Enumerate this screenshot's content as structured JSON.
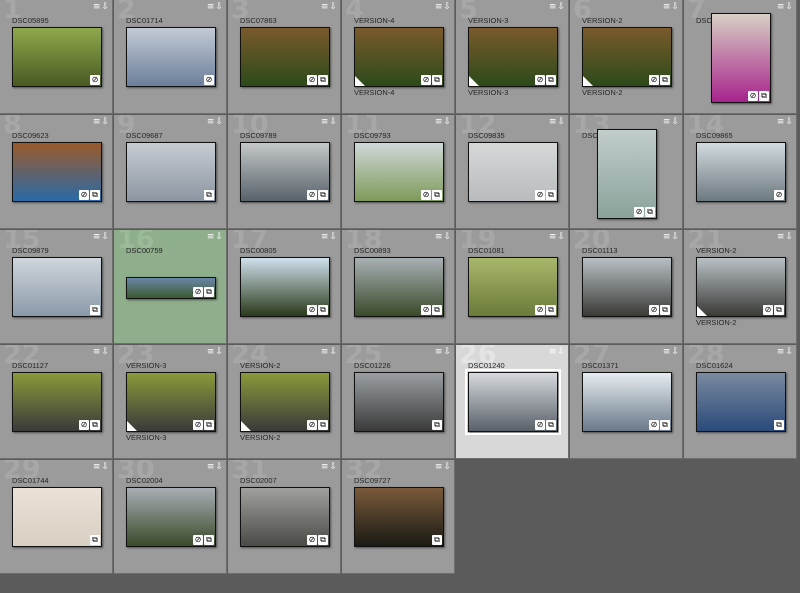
{
  "cells": [
    {
      "num": "1",
      "name": "DSC05895",
      "colors": [
        "#4a5a24",
        "#8fa84a"
      ],
      "orient": "land",
      "icons": [
        "tag"
      ]
    },
    {
      "num": "2",
      "name": "DSC01714",
      "colors": [
        "#6c7f9a",
        "#c3cad6"
      ],
      "orient": "land",
      "icons": [
        "tag"
      ]
    },
    {
      "num": "3",
      "name": "DSC07863",
      "colors": [
        "#2c4a1a",
        "#7a5a2c"
      ],
      "orient": "land",
      "icons": [
        "tag",
        "stack"
      ]
    },
    {
      "num": "4",
      "name": "VERSION-4",
      "colors": [
        "#2c4a1a",
        "#7a5a2c"
      ],
      "orient": "land",
      "icons": [
        "tag",
        "stack"
      ],
      "version": "VERSION-4"
    },
    {
      "num": "5",
      "name": "VERSION-3",
      "colors": [
        "#2c4a1a",
        "#7a5a2c"
      ],
      "orient": "land",
      "icons": [
        "tag",
        "stack"
      ],
      "version": "VERSION-3"
    },
    {
      "num": "6",
      "name": "VERSION-2",
      "colors": [
        "#2c4a1a",
        "#7a5a2c"
      ],
      "orient": "land",
      "icons": [
        "tag",
        "stack"
      ],
      "version": "VERSION-2"
    },
    {
      "num": "7",
      "name": "DSC09582",
      "colors": [
        "#a7238c",
        "#d8d0c4"
      ],
      "orient": "port",
      "icons": [
        "tag",
        "stack"
      ]
    },
    {
      "num": "8",
      "name": "DSC09623",
      "colors": [
        "#2a6aa8",
        "#9a5a2a"
      ],
      "orient": "land",
      "icons": [
        "tag",
        "stack"
      ]
    },
    {
      "num": "9",
      "name": "DSC09687",
      "colors": [
        "#8c96a2",
        "#c7ccd2"
      ],
      "orient": "land",
      "icons": [
        "stack"
      ]
    },
    {
      "num": "10",
      "name": "DSC09789",
      "colors": [
        "#58626a",
        "#c4c8c8"
      ],
      "orient": "land",
      "icons": [
        "tag",
        "stack"
      ]
    },
    {
      "num": "11",
      "name": "DSC09793",
      "colors": [
        "#7e9a5a",
        "#cfd8d8"
      ],
      "orient": "land",
      "icons": [
        "tag",
        "stack"
      ]
    },
    {
      "num": "12",
      "name": "DSC09835",
      "colors": [
        "#b8bcbe",
        "#d6d8d8"
      ],
      "orient": "land",
      "icons": [
        "tag",
        "stack"
      ]
    },
    {
      "num": "13",
      "name": "DSC09859",
      "colors": [
        "#8aa29a",
        "#c2cdcc"
      ],
      "orient": "port",
      "icons": [
        "tag",
        "stack"
      ]
    },
    {
      "num": "14",
      "name": "DSC09865",
      "colors": [
        "#6c7a80",
        "#d2dade"
      ],
      "orient": "land",
      "icons": [
        "tag"
      ]
    },
    {
      "num": "15",
      "name": "DSC09879",
      "colors": [
        "#8a9aa8",
        "#cfd6dc"
      ],
      "orient": "land",
      "icons": [
        "stack"
      ]
    },
    {
      "num": "16",
      "name": "DSC00759",
      "colors": [
        "#3c5a30",
        "#6a86a8"
      ],
      "orient": "pano",
      "icons": [
        "tag",
        "stack"
      ]
    },
    {
      "num": "17",
      "name": "DSC00805",
      "colors": [
        "#2a3a1a",
        "#cfe0ec"
      ],
      "orient": "land",
      "icons": [
        "tag",
        "stack"
      ]
    },
    {
      "num": "18",
      "name": "DSC00893",
      "colors": [
        "#3a4a2a",
        "#a8b0b4"
      ],
      "orient": "land",
      "icons": [
        "tag",
        "stack"
      ]
    },
    {
      "num": "19",
      "name": "DSC01081",
      "colors": [
        "#6a7a3a",
        "#a8b86a"
      ],
      "orient": "land",
      "icons": [
        "tag",
        "stack"
      ]
    },
    {
      "num": "20",
      "name": "DSC01113",
      "colors": [
        "#3a3a36",
        "#b8c0c4"
      ],
      "orient": "land",
      "icons": [
        "tag",
        "stack"
      ]
    },
    {
      "num": "21",
      "name": "VERSION-2",
      "colors": [
        "#3a3a36",
        "#b8c0c4"
      ],
      "orient": "land",
      "icons": [
        "tag",
        "stack"
      ],
      "version": "VERSION-2"
    },
    {
      "num": "22",
      "name": "DSC01127",
      "colors": [
        "#3a3a3a",
        "#8a9a3a"
      ],
      "orient": "land",
      "icons": [
        "tag",
        "stack"
      ]
    },
    {
      "num": "23",
      "name": "VERSION-3",
      "colors": [
        "#3a3a3a",
        "#8a9a3a"
      ],
      "orient": "land",
      "icons": [
        "tag",
        "stack"
      ],
      "version": "VERSION-3"
    },
    {
      "num": "24",
      "name": "VERSION-2",
      "colors": [
        "#3a3a3a",
        "#8a9a3a"
      ],
      "orient": "land",
      "icons": [
        "tag",
        "stack"
      ],
      "version": "VERSION-2"
    },
    {
      "num": "25",
      "name": "DSC01226",
      "colors": [
        "#3a3a3a",
        "#9a9ea2"
      ],
      "orient": "land",
      "icons": [
        "stack"
      ]
    },
    {
      "num": "26",
      "name": "DSC01240",
      "colors": [
        "#5a6068",
        "#d6dade"
      ],
      "orient": "land",
      "icons": [
        "tag",
        "stack"
      ],
      "selected": true
    },
    {
      "num": "27",
      "name": "DSC01371",
      "colors": [
        "#6a7a8a",
        "#e6ecf0"
      ],
      "orient": "land",
      "icons": [
        "tag",
        "stack"
      ]
    },
    {
      "num": "28",
      "name": "DSC01624",
      "colors": [
        "#2a4a7a",
        "#7a8aa0"
      ],
      "orient": "land",
      "icons": [
        "stack"
      ]
    },
    {
      "num": "29",
      "name": "DSC01744",
      "colors": [
        "#d6cfc2",
        "#eae2d6"
      ],
      "orient": "land",
      "icons": [
        "stack"
      ]
    },
    {
      "num": "30",
      "name": "DSC02004",
      "colors": [
        "#3a4a2a",
        "#a8aeb4"
      ],
      "orient": "land",
      "icons": [
        "tag",
        "stack"
      ]
    },
    {
      "num": "31",
      "name": "DSC02007",
      "colors": [
        "#4a4a46",
        "#a0a09c"
      ],
      "orient": "land",
      "icons": [
        "tag",
        "stack"
      ]
    },
    {
      "num": "32",
      "name": "DSC09727",
      "colors": [
        "#1a1a14",
        "#7a5a3a"
      ],
      "orient": "land",
      "icons": [
        "stack"
      ]
    }
  ],
  "badge": "≡⇩",
  "icon_glyphs": {
    "tag": "⊘",
    "stack": "⧉"
  },
  "highlight_cell": "16"
}
